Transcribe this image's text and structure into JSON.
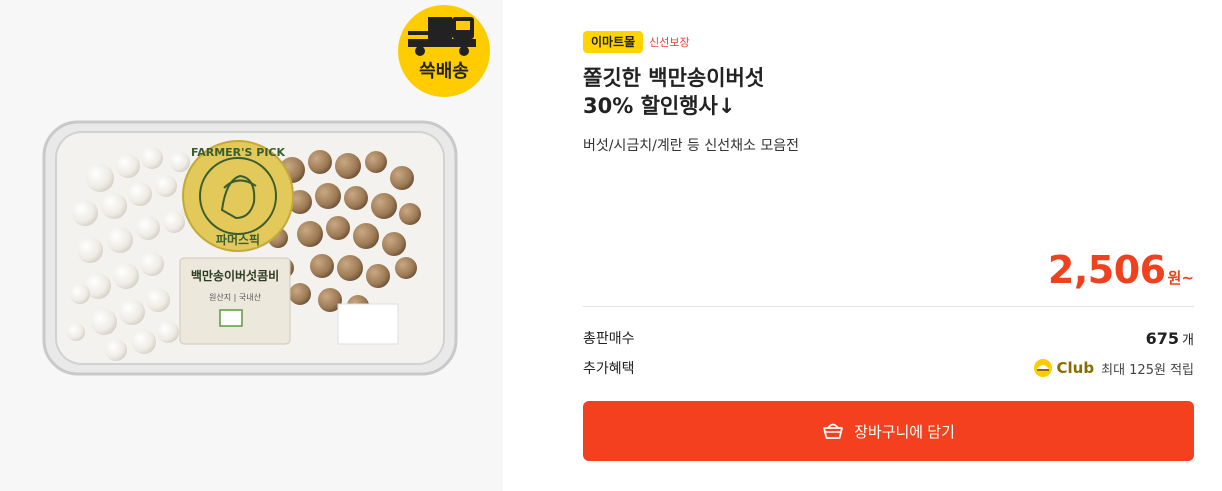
{
  "badge": {
    "label": "쓱배송"
  },
  "product_image": {
    "sticker_en": "FARMER'S PICK",
    "sticker_ko": "파머스픽",
    "package_label": "백만송이버섯콤비",
    "package_origin": "원산지 | 국내산"
  },
  "product": {
    "mall_tag": "이마트몰",
    "fresh_tag": "신선보장",
    "title_line1": "쫄깃한 백만송이버섯",
    "title_line2": "30% 할인행사↓",
    "subtitle": "버섯/시금치/계란 등 신선채소 모음전"
  },
  "price": {
    "amount": "2,506",
    "unit": "원~"
  },
  "info": {
    "sales_label": "총판매수",
    "sales_count": "675",
    "sales_unit": "개",
    "benefit_label": "추가혜택",
    "club_label": "Club",
    "benefit_text": "최대 125원 적립"
  },
  "cart_button": {
    "label": "장바구니에 담기"
  },
  "colors": {
    "accent": "#f4401f",
    "badge": "#ffcc00",
    "mall_tag": "#ffd400"
  },
  "icons": [
    "truck-icon",
    "club-icon",
    "cart-icon"
  ]
}
